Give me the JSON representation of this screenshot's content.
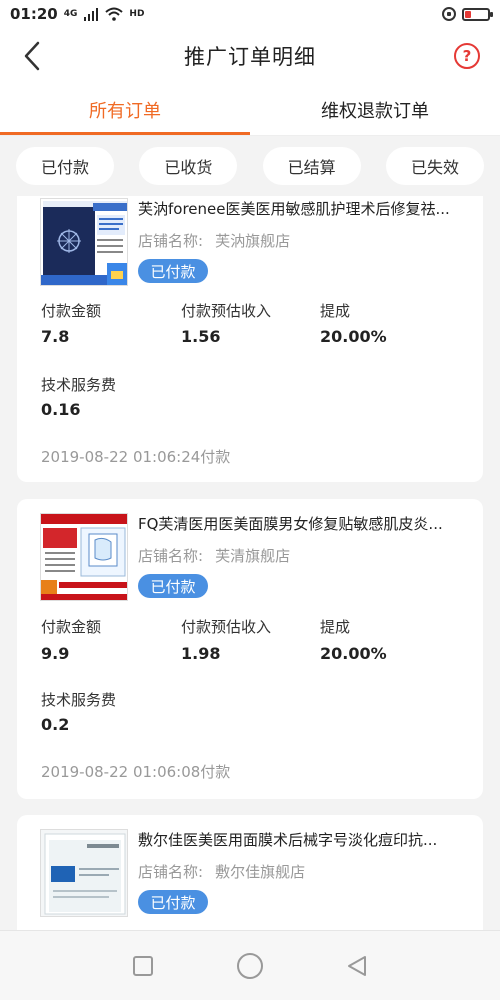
{
  "status_bar": {
    "time": "01:20",
    "network_badge": "4G",
    "hd_badge": "HD"
  },
  "header": {
    "title": "推广订单明细",
    "help_label": "?"
  },
  "tabs": [
    {
      "label": "所有订单",
      "active": true
    },
    {
      "label": "维权退款订单",
      "active": false
    }
  ],
  "filters": [
    {
      "label": "已付款"
    },
    {
      "label": "已收货"
    },
    {
      "label": "已结算"
    },
    {
      "label": "已失效"
    }
  ],
  "orders": [
    {
      "title": "芙汭forenee医美医用敏感肌护理术后修复祛...",
      "shop_label": "店铺名称:",
      "shop_name": "芙汭旗舰店",
      "status": "已付款",
      "pay_amount_label": "付款金额",
      "pay_amount": "7.8",
      "est_income_label": "付款预估收入",
      "est_income": "1.56",
      "commission_label": "提成",
      "commission": "20.00%",
      "service_fee_label": "技术服务费",
      "service_fee": "0.16",
      "timeline": "2019-08-22 01:06:24付款"
    },
    {
      "title": "FQ芙清医用医美面膜男女修复贴敏感肌皮炎...",
      "shop_label": "店铺名称:",
      "shop_name": "芙清旗舰店",
      "status": "已付款",
      "pay_amount_label": "付款金额",
      "pay_amount": "9.9",
      "est_income_label": "付款预估收入",
      "est_income": "1.98",
      "commission_label": "提成",
      "commission": "20.00%",
      "service_fee_label": "技术服务费",
      "service_fee": "0.2",
      "timeline": "2019-08-22 01:06:08付款"
    },
    {
      "title": "敷尔佳医美医用面膜术后械字号淡化痘印抗...",
      "shop_label": "店铺名称:",
      "shop_name": "敷尔佳旗舰店",
      "status": "已付款"
    }
  ],
  "colors": {
    "accent": "#f06a24",
    "badge": "#4a90e2",
    "help": "#e53935"
  }
}
